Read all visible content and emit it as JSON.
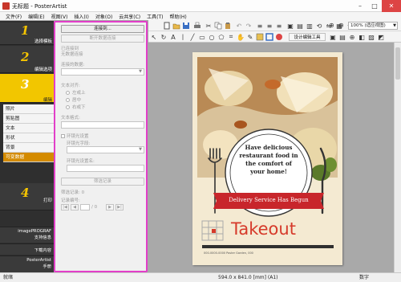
{
  "window": {
    "title": "无标题 - PosterArtist"
  },
  "menu": [
    "文件(F)",
    "编辑(E)",
    "视图(V)",
    "插入(I)",
    "对象(O)",
    "云共享(C)",
    "工具(T)",
    "帮助(H)"
  ],
  "sidebar": {
    "steps": [
      {
        "num": "1",
        "label": "选择模板"
      },
      {
        "num": "2",
        "label": "编辑选项"
      },
      {
        "num": "3",
        "label": "编辑"
      },
      {
        "num": "4",
        "label": "打印"
      }
    ],
    "subitems": [
      "照片",
      "剪贴图",
      "文本",
      "形状",
      "背景",
      "可变数据"
    ],
    "bottom": [
      {
        "line1": "imagePROGRAF",
        "line2": "支持信息"
      },
      {
        "line1": "下载内容",
        "line2": ""
      },
      {
        "line1": "PosterArtist",
        "line2": "手册"
      }
    ]
  },
  "panel": {
    "connect_button": "连接到...",
    "disconnect_button": "断开数据连接",
    "connected_to_label": "已连接到",
    "connected_to_value": "无数据连接",
    "selected_data_label": "连接的数据:",
    "text_align_label": "文本对齐:",
    "align_options": [
      "左或上",
      "居中",
      "右或下"
    ],
    "text_format_label": "文本格式:",
    "filter_checkbox_label": "环镜光设置",
    "filter_field_label": "环镜光字段:",
    "filter_setting_label": "环镜光设置名:",
    "filter_records_button": "筛选记录",
    "records_filtered_label": "筛选记录:",
    "records_filtered_value": "0",
    "record_number_label": "记录编号:",
    "record_nav_text": "/ 0"
  },
  "toolbar": {
    "design_button": "设计编辑工具",
    "zoom_value": "100% (适应视图)"
  },
  "poster": {
    "headline": "Have delicious restaurant food in the comfort of your home!",
    "banner": "Delivery Service Has Begun",
    "brand": "Takeout",
    "small_text": "000-0000-0000  Poster Garden, 000"
  },
  "status": {
    "left": "就绪",
    "center": "594.0 x 841.0 [mm] (A1)",
    "right": "数字"
  },
  "colors": {
    "accent": "#e23fc9",
    "step_active": "#f2c600",
    "banner_red": "#c8262b",
    "brand_red": "#d63a2a"
  }
}
